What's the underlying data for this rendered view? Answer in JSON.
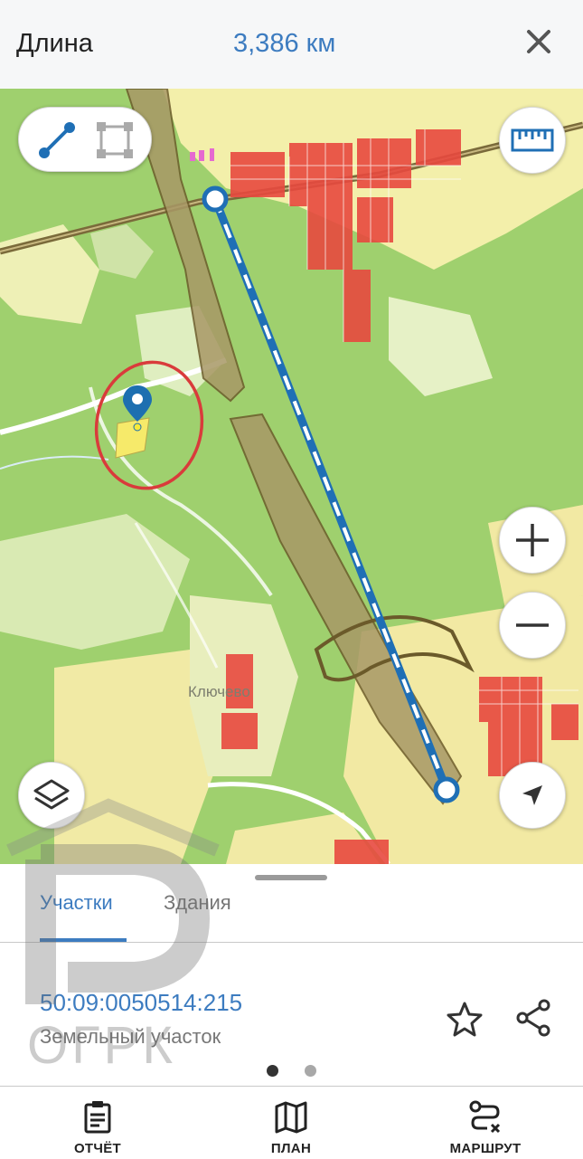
{
  "header": {
    "title": "Длина",
    "distance": "3,386 км"
  },
  "map": {
    "place_label": "Ключево",
    "tools": {
      "line_active": true
    },
    "colors": {
      "measure_line": "#1f6fb5",
      "marker": "#1d6fb0",
      "circle_annotation": "#d93b3b"
    }
  },
  "sheet": {
    "tabs": [
      "Участки",
      "Здания"
    ],
    "active_tab": 0,
    "parcel_number": "50:09:0050514:215",
    "parcel_type": "Земельный участок",
    "page_count": 2,
    "current_page": 0
  },
  "bottom_nav": {
    "items": [
      {
        "label": "ОТЧЁТ",
        "icon": "report-icon"
      },
      {
        "label": "ПЛАН",
        "icon": "map-icon"
      },
      {
        "label": "МАРШРУТ",
        "icon": "route-icon"
      }
    ]
  },
  "watermark": {
    "text": "ОГРК"
  }
}
